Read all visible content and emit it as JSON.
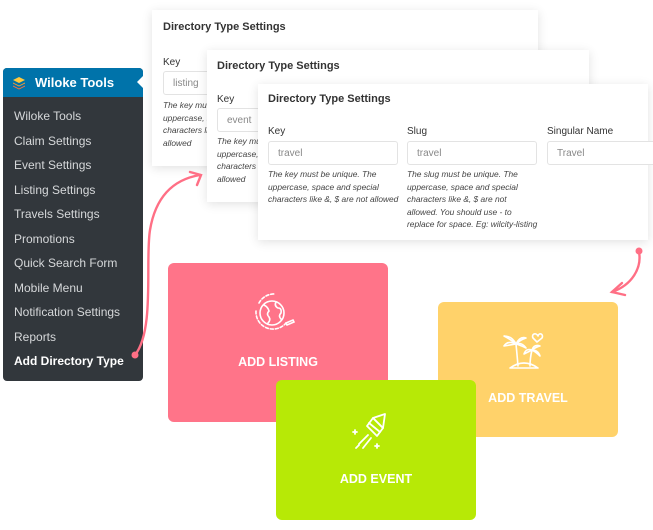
{
  "sidebar": {
    "title": "Wiloke Tools",
    "logo_icon": "layers-icon",
    "items": [
      {
        "label": "Wiloke Tools",
        "active": false
      },
      {
        "label": "Claim Settings",
        "active": false
      },
      {
        "label": "Event Settings",
        "active": false
      },
      {
        "label": "Listing Settings",
        "active": false
      },
      {
        "label": "Travels Settings",
        "active": false
      },
      {
        "label": "Promotions",
        "active": false
      },
      {
        "label": "Quick Search Form",
        "active": false
      },
      {
        "label": "Mobile Menu",
        "active": false
      },
      {
        "label": "Notification Settings",
        "active": false
      },
      {
        "label": "Reports",
        "active": false
      },
      {
        "label": "Add Directory Type",
        "active": true
      }
    ]
  },
  "panels": [
    {
      "title": "Directory Type Settings",
      "key_label": "Key",
      "key_value": "listing",
      "key_help": "The key must be unique. The uppercase, space and special characters like &, $ are not allowed"
    },
    {
      "title": "Directory Type Settings",
      "key_label": "Key",
      "key_value": "event",
      "key_help": "The key must be unique. The uppercase, space and special characters like &, $ are not allowed"
    },
    {
      "title": "Directory Type Settings",
      "key_label": "Key",
      "key_value": "travel",
      "key_help": "The key must be unique. The uppercase, space and special characters like &, $ are not allowed",
      "slug_label": "Slug",
      "slug_value": "travel",
      "slug_help": "The slug must be unique. The uppercase, space and special characters like &, $ are not allowed. You should use - to replace for space. Eg: wilcity-listing",
      "singular_label": "Singular Name",
      "singular_value": "Travel"
    }
  ],
  "cards": {
    "listing": {
      "label": "ADD LISTING",
      "icon": "globe-plane-icon",
      "color": "#ff7489"
    },
    "event": {
      "label": "ADD EVENT",
      "icon": "rocket-icon",
      "color": "#b7e906"
    },
    "travel": {
      "label": "ADD TRAVEL",
      "icon": "palm-island-icon",
      "color": "#ffd26a"
    }
  },
  "colors": {
    "accent_arrow": "#ff6f85",
    "sidebar_bg": "#32373c",
    "sidebar_header": "#0073aa"
  }
}
